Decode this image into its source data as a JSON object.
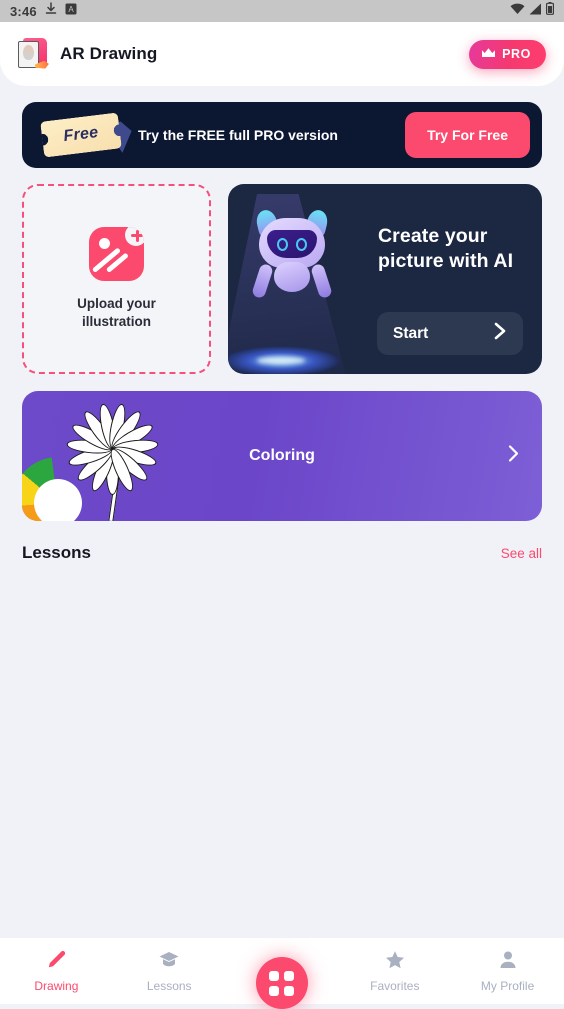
{
  "statusbar": {
    "time": "3:46",
    "icons": [
      "download-icon",
      "app-badge-icon",
      "wifi-icon",
      "signal-icon",
      "battery-icon"
    ]
  },
  "header": {
    "app_title": "AR Drawing",
    "app_icon": "sketchbook-icon",
    "pro_label": "PRO",
    "pro_icon": "crown-icon"
  },
  "promo": {
    "ticket_text": "Free",
    "message": "Try the FREE full PRO version",
    "button_label": "Try For Free"
  },
  "upload_card": {
    "label": "Upload your\nillustration",
    "label_line1": "Upload your",
    "label_line2": "illustration",
    "icon": "image-plus-icon"
  },
  "ai_card": {
    "title_line1": "Create your",
    "title_line2": "picture with AI",
    "button_label": "Start",
    "chevron": "chevron-right-icon"
  },
  "coloring_card": {
    "label": "Coloring",
    "chevron": "chevron-right-icon"
  },
  "lessons_section": {
    "title": "Lessons",
    "see_all": "See all"
  },
  "bottomnav": {
    "items": [
      {
        "label": "Drawing",
        "icon": "pencil-icon",
        "active": true
      },
      {
        "label": "Lessons",
        "icon": "graduation-cap-icon",
        "active": false
      },
      {
        "label": "Favorites",
        "icon": "star-icon",
        "active": false
      },
      {
        "label": "My Profile",
        "icon": "person-icon",
        "active": false
      }
    ],
    "fab": "grid-icon"
  },
  "colors": {
    "accent_pink": "#fb4a6d",
    "pro_gradient_start": "#e6399b",
    "pro_gradient_end": "#ff3d6e",
    "banner_navy": "#0c1732",
    "ai_card_navy": "#1c2742",
    "coloring_purple": "#6b46c9",
    "background": "#f1f2f7",
    "inactive_nav": "#a9b0c0"
  }
}
